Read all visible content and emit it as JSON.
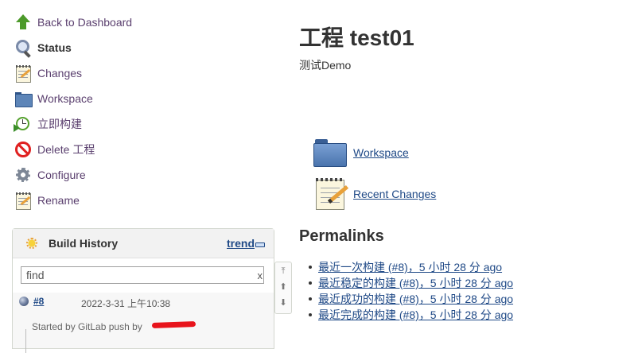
{
  "tasks": [
    {
      "label": "Back to Dashboard",
      "icon": "arrow-up-icon"
    },
    {
      "label": "Status",
      "icon": "magnifier-icon"
    },
    {
      "label": "Changes",
      "icon": "notepad-icon"
    },
    {
      "label": "Workspace",
      "icon": "folder-icon"
    },
    {
      "label": "立即构建",
      "icon": "clock-play-icon"
    },
    {
      "label": "Delete 工程",
      "icon": "no-entry-icon"
    },
    {
      "label": "Configure",
      "icon": "gear-icon"
    },
    {
      "label": "Rename",
      "icon": "notepad-icon"
    }
  ],
  "build_history": {
    "title": "Build History",
    "trend_label": "trend",
    "search_value": "find",
    "clear_label": "x",
    "builds": [
      {
        "number": "#8",
        "date": "2022-3-31 上午10:38",
        "started_by": "Started by GitLab push by"
      }
    ]
  },
  "pager": {
    "top": "⤒",
    "up": "⬆",
    "down": "⬇"
  },
  "main": {
    "title": "工程 test01",
    "description": "测试Demo",
    "links": [
      {
        "label": "Workspace",
        "icon": "folder-icon"
      },
      {
        "label": "Recent Changes",
        "icon": "notepad-icon"
      }
    ],
    "permalinks_title": "Permalinks",
    "permalinks": [
      "最近一次构建 (#8)，5 小时 28 分 ago",
      "最近稳定的构建 (#8)，5 小时 28 分 ago",
      "最近成功的构建 (#8)，5 小时 28 分 ago",
      "最近完成的构建 (#8)，5 小时 28 分 ago"
    ]
  },
  "colors": {
    "link": "#204a87",
    "side_link": "#5a3f6e",
    "redaction": "#e8141c"
  }
}
